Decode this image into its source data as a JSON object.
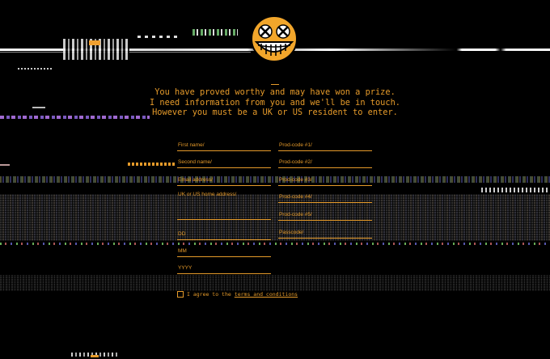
{
  "message": {
    "line1": "You have proved worthy and may have won a prize.",
    "line2": "I need information from you and we'll be in touch.",
    "line3": "However you must be a UK or US resident to enter."
  },
  "form": {
    "left": {
      "first_name": "First name/",
      "second_name": "Second name/",
      "email": "Email address/",
      "address": "UK or US home address/",
      "dd": "DD",
      "mm": "MM",
      "yyyy": "YYYY"
    },
    "right": {
      "prod1": "Prod-code #1/",
      "prod2": "Prod-code #2/",
      "prod3": "Prod-code #3/",
      "prod4": "Prod-code #4/",
      "prod5": "Prod-code #5/",
      "passcode": "Passcode/"
    },
    "agree_prefix": "I agree to the",
    "terms_link": "terms and conditions"
  },
  "colors": {
    "accent": "#e59a2a",
    "background": "#000000"
  },
  "icons": {
    "face": "dizzy-grin-face-icon"
  }
}
